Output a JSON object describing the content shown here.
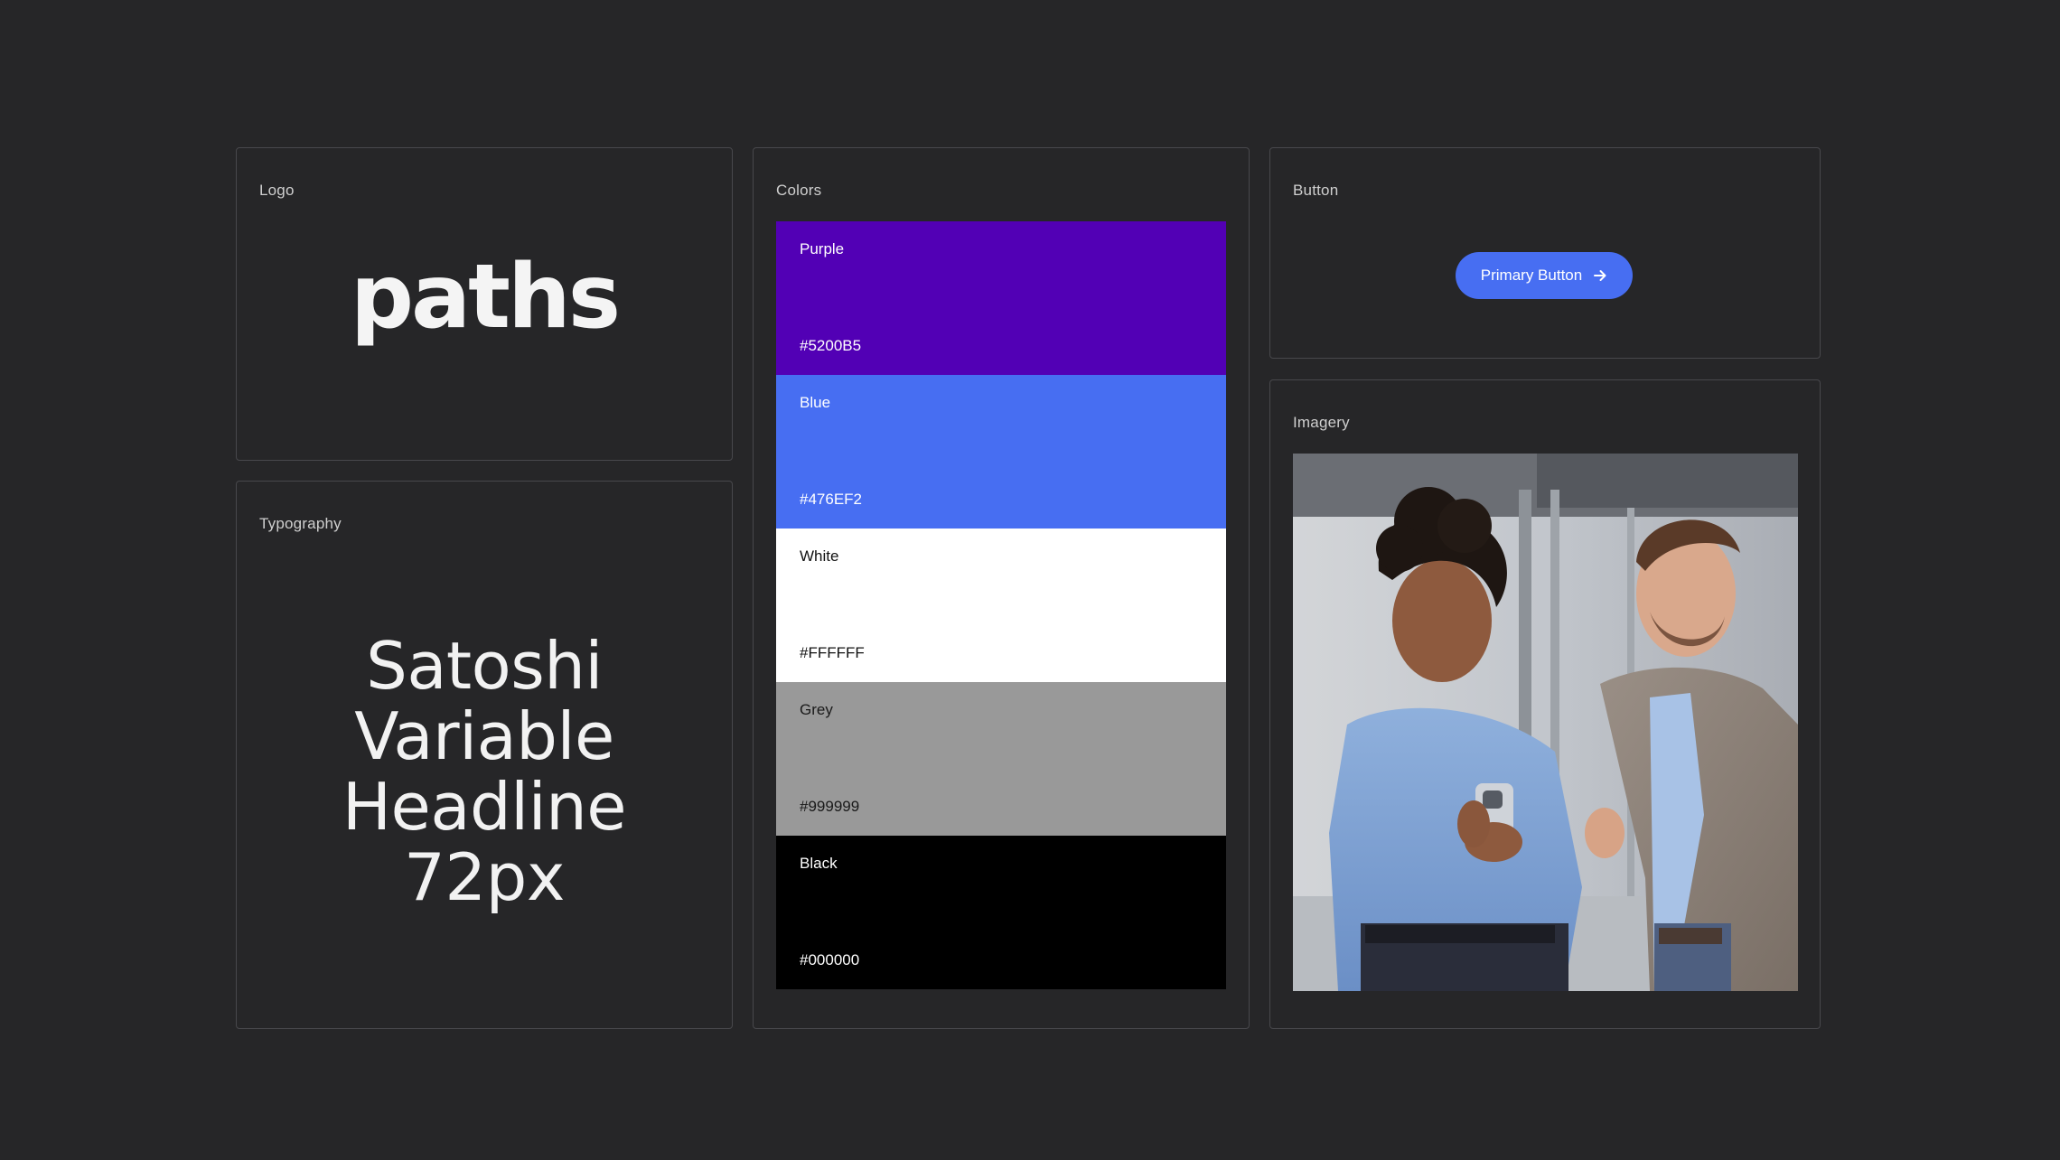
{
  "logo": {
    "label": "Logo",
    "wordmark": "paths"
  },
  "typography": {
    "label": "Typography",
    "lines": [
      "Satoshi",
      "Variable",
      "Headline",
      "72px"
    ]
  },
  "colors": {
    "label": "Colors",
    "swatches": [
      {
        "name": "Purple",
        "hex": "#5200B5",
        "text_color": "#ffffff"
      },
      {
        "name": "Blue",
        "hex": "#476EF2",
        "text_color": "#ffffff"
      },
      {
        "name": "White",
        "hex": "#FFFFFF",
        "text_color": "#111111"
      },
      {
        "name": "Grey",
        "hex": "#999999",
        "text_color": "#1a1a1a"
      },
      {
        "name": "Black",
        "hex": "#000000",
        "text_color": "#ffffff"
      }
    ]
  },
  "button": {
    "label": "Button",
    "primary_label": "Primary Button",
    "icon": "arrow-right-icon",
    "color": "#476EF2"
  },
  "imagery": {
    "label": "Imagery"
  }
}
